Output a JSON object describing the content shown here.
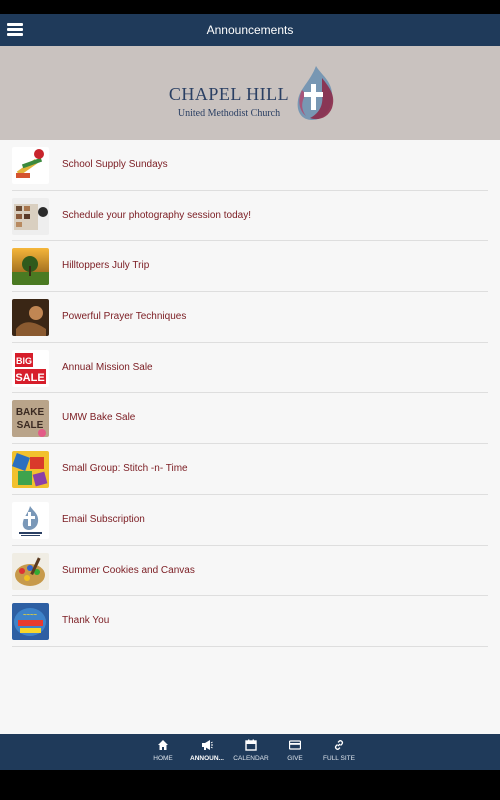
{
  "header": {
    "title": "Announcements"
  },
  "banner": {
    "name": "CHAPEL HILL",
    "subtitle": "United Methodist Church"
  },
  "colors": {
    "bar": "#1f3a5a",
    "banner": "#c9c2bf",
    "link": "#7b1c22"
  },
  "announcements": [
    {
      "label": "School Supply Sundays"
    },
    {
      "label": "Schedule your photography session today!"
    },
    {
      "label": "Hilltoppers July Trip"
    },
    {
      "label": "Powerful Prayer Techniques"
    },
    {
      "label": "Annual Mission Sale"
    },
    {
      "label": "UMW Bake Sale"
    },
    {
      "label": "Small Group: Stitch -n- Time"
    },
    {
      "label": "Email Subscription"
    },
    {
      "label": "Summer Cookies and Canvas"
    },
    {
      "label": "Thank You"
    }
  ],
  "tabs": [
    {
      "label": "HOME",
      "icon": "home-icon"
    },
    {
      "label": "ANNOUN...",
      "icon": "megaphone-icon",
      "active": true
    },
    {
      "label": "CALENDAR",
      "icon": "calendar-icon"
    },
    {
      "label": "GIVE",
      "icon": "credit-card-icon"
    },
    {
      "label": "FULL SITE",
      "icon": "link-icon"
    }
  ]
}
